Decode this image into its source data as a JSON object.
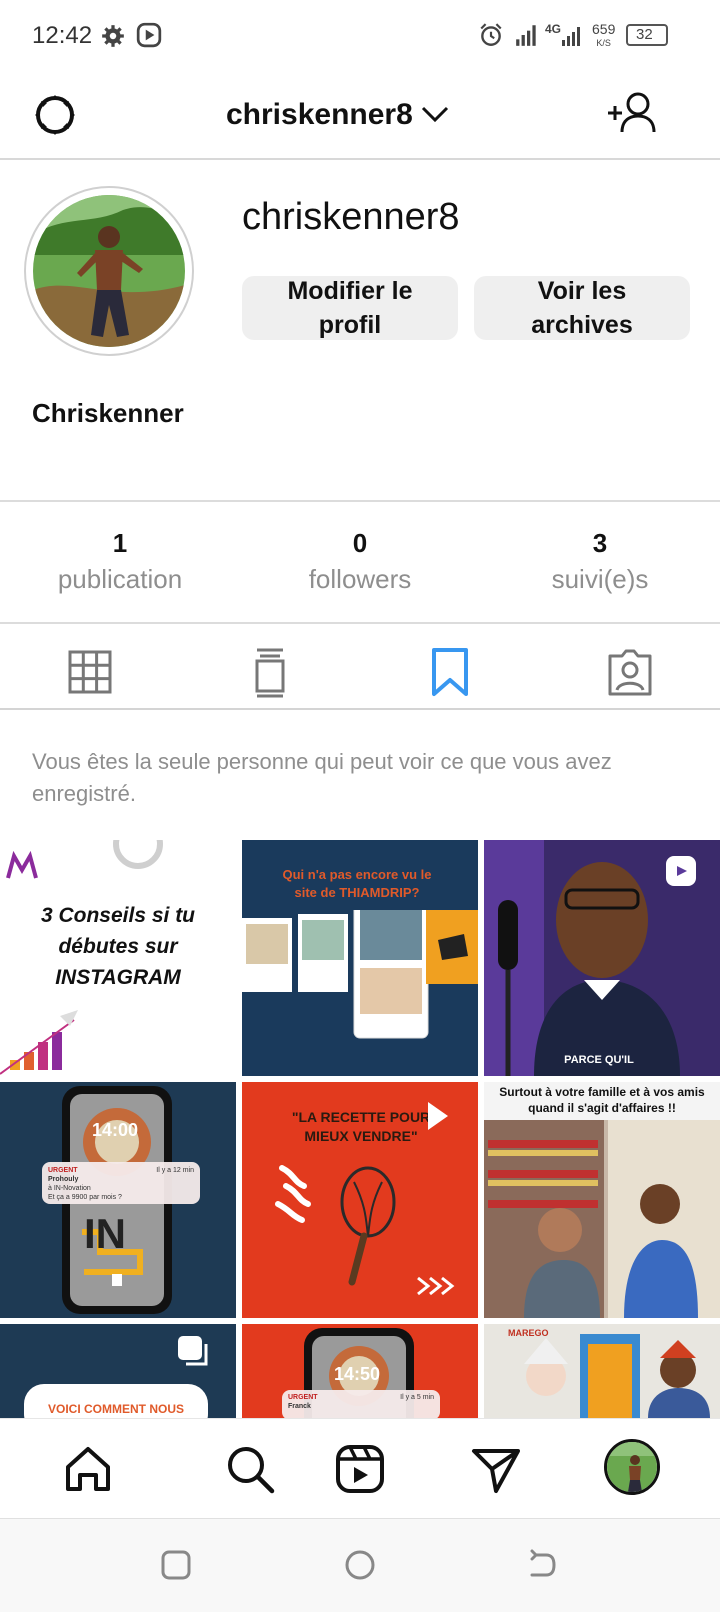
{
  "status_bar": {
    "time": "12:42",
    "network_label": "4G",
    "speed_value": "659",
    "speed_unit": "K/S",
    "battery": "32",
    "icons": [
      "gear-icon",
      "play-circle-icon",
      "alarm-icon",
      "signal-icon",
      "signal-4g-icon",
      "battery-icon"
    ]
  },
  "top_nav": {
    "username": "chriskenner8",
    "icons": [
      "settings-icon",
      "chevron-down-icon",
      "add-user-icon"
    ]
  },
  "profile": {
    "username": "chriskenner8",
    "full_name": "Chriskenner",
    "edit_button": "Modifier le profil",
    "archive_button": "Voir les archives"
  },
  "stats": [
    {
      "value": "1",
      "label": "publication"
    },
    {
      "value": "0",
      "label": "followers"
    },
    {
      "value": "3",
      "label": "suivi(e)s"
    }
  ],
  "tabs": [
    {
      "icon": "grid-icon",
      "active": false
    },
    {
      "icon": "igtv-icon",
      "active": false
    },
    {
      "icon": "bookmark-icon",
      "active": true
    },
    {
      "icon": "tagged-icon",
      "active": false
    }
  ],
  "accent_color": "#3897f0",
  "saved_note": "Vous êtes la seule personne qui peut voir ce que vous avez enregistré.",
  "grid": {
    "tile1": {
      "text": "3 Conseils si tu débutes sur INSTAGRAM"
    },
    "tile2": {
      "text_a": "Qui n'a pas encore vu le site de THIAMDRIP?"
    },
    "tile3": {
      "caption": "PARCE QU'IL"
    },
    "tile4": {
      "time": "14:00",
      "alert_tag": "URGENT",
      "alert_name": "Prohouly",
      "alert_line1": "à IN-Novation",
      "alert_line2": "Et ça a 9900 par mois ?",
      "alert_ago": "Il y a 12 min",
      "brand": "IN"
    },
    "tile5": {
      "text": "\"LA RECETTE POUR MIEUX VENDRE\""
    },
    "tile6": {
      "text": "Surtout à votre famille et à vos amis quand il s'agit d'affaires !!"
    },
    "tile7": {
      "text": "VOICI COMMENT NOUS AIDONS"
    },
    "tile8": {
      "time": "14:50",
      "alert_tag": "URGENT",
      "alert_name": "Franck",
      "alert_ago": "Il y a 5 min"
    },
    "tile9": {
      "logo": "MAREGO"
    }
  },
  "bottom_nav": [
    "home-icon",
    "search-icon",
    "reels-icon",
    "direct-icon",
    "profile-avatar"
  ],
  "system_nav": [
    "recent-apps-icon",
    "home-circle-icon",
    "back-icon"
  ]
}
